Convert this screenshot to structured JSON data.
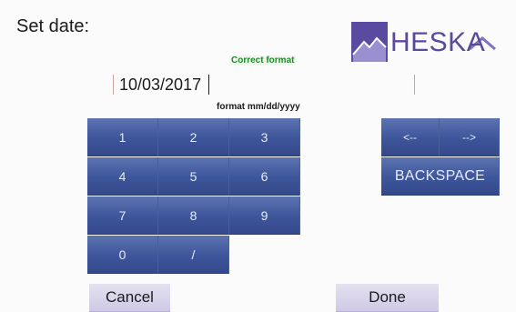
{
  "header": {
    "title": "Set date:",
    "logo_text": "HESKA"
  },
  "date_input": {
    "value": "10/03/2017",
    "status": "Correct format",
    "format_hint": "format mm/dd/yyyy"
  },
  "keypad": {
    "keys": [
      "1",
      "2",
      "3",
      "4",
      "5",
      "6",
      "7",
      "8",
      "9",
      "0",
      "/"
    ]
  },
  "navigation": {
    "left_arrow": "<--",
    "right_arrow": "-->",
    "backspace": "BACKSPACE"
  },
  "actions": {
    "cancel": "Cancel",
    "done": "Done"
  },
  "colors": {
    "key_blue": "#3d559a",
    "button_lavender": "#cfc9e5",
    "status_green": "#1f8a2b",
    "logo_purple": "#5b4a9c"
  }
}
